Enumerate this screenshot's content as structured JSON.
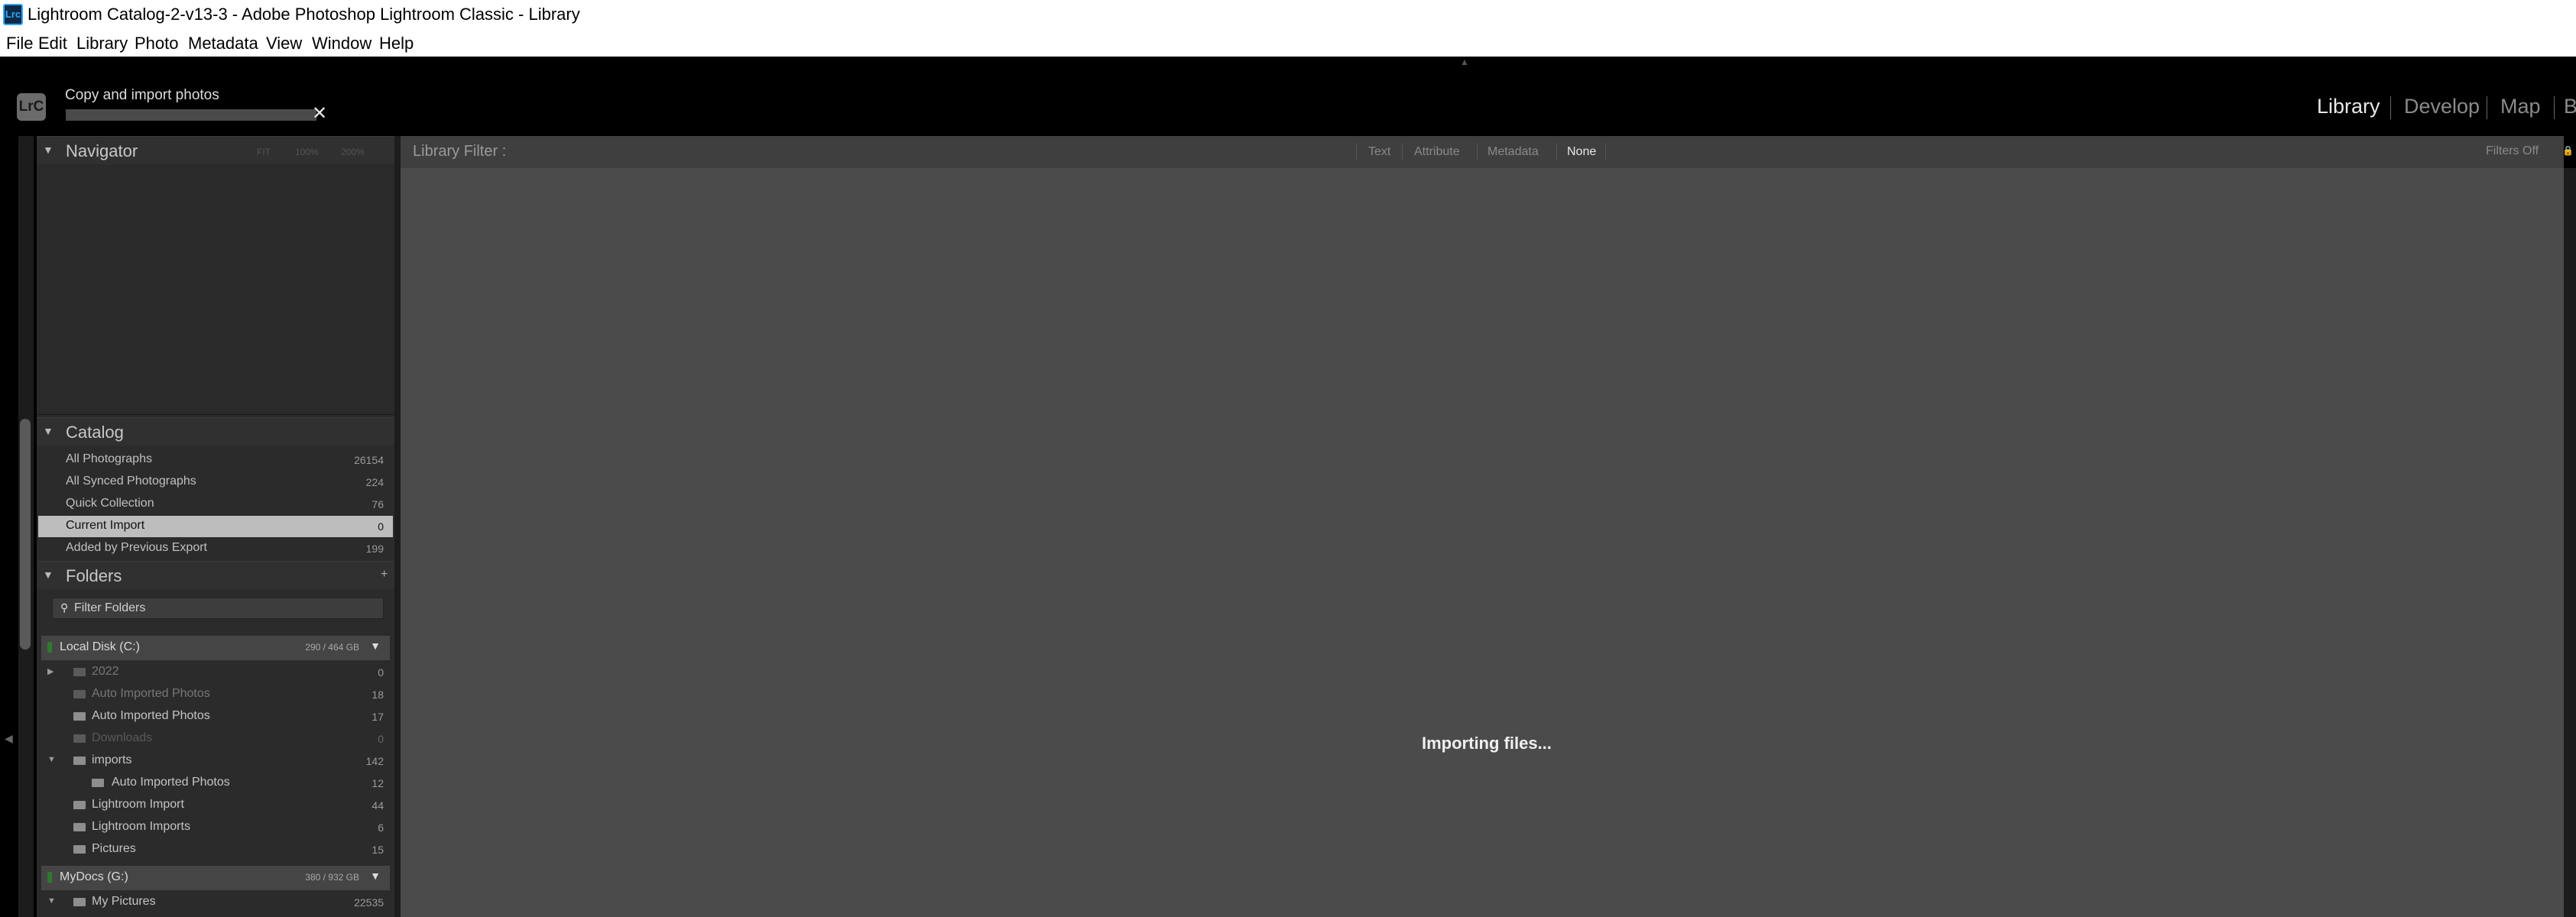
{
  "window": {
    "app_icon_text": "Lrc",
    "title": "Lightroom Catalog-2-v13-3 - Adobe Photoshop Lightroom Classic - Library"
  },
  "menu": [
    "File",
    "Edit",
    "Library",
    "Photo",
    "Metadata",
    "View",
    "Window",
    "Help"
  ],
  "header": {
    "logo_text": "LrC",
    "import_title": "Copy and import photos",
    "import_progress": 0,
    "cancel_icon": "close-icon",
    "modules": [
      {
        "label": "Library",
        "active": true
      },
      {
        "label": "Develop",
        "active": false
      },
      {
        "label": "Map",
        "active": false
      },
      {
        "label": "B",
        "active": false
      }
    ]
  },
  "navigator": {
    "title": "Navigator",
    "zoom_options": [
      "FIT",
      "100%",
      "200%"
    ]
  },
  "catalog": {
    "title": "Catalog",
    "items": [
      {
        "label": "All Photographs",
        "count": "26154"
      },
      {
        "label": "All Synced Photographs",
        "count": "224"
      },
      {
        "label": "Quick Collection",
        "count": "76"
      },
      {
        "label": "Current Import",
        "count": "0",
        "selected": true
      },
      {
        "label": "Added by Previous Export",
        "count": "199"
      }
    ]
  },
  "folders": {
    "title": "Folders",
    "add_label": "+",
    "filter_placeholder": "Filter Folders",
    "volumes": [
      {
        "name": "Local Disk (C:)",
        "size": "290 / 464 GB"
      },
      {
        "name": "MyDocs (G:)",
        "size": "380 / 932 GB"
      }
    ],
    "items": [
      {
        "label": "2022",
        "count": "0"
      },
      {
        "label": "Auto Imported Photos",
        "count": "18"
      },
      {
        "label": "Auto Imported Photos",
        "count": "17"
      },
      {
        "label": "Downloads",
        "count": "0"
      },
      {
        "label": "imports",
        "count": "142"
      },
      {
        "label": "Auto Imported Photos",
        "count": "12"
      },
      {
        "label": "Lightroom Import",
        "count": "44"
      },
      {
        "label": "Lightroom Imports",
        "count": "6"
      },
      {
        "label": "Pictures",
        "count": "15"
      },
      {
        "label": "My Pictures",
        "count": "22535"
      }
    ]
  },
  "filter_bar": {
    "label": "Library Filter :",
    "tabs": [
      {
        "label": "Text",
        "active": false
      },
      {
        "label": "Attribute",
        "active": false
      },
      {
        "label": "Metadata",
        "active": false
      },
      {
        "label": "None",
        "active": true
      }
    ],
    "filters_off": "Filters Off"
  },
  "main": {
    "status": "Importing files..."
  }
}
